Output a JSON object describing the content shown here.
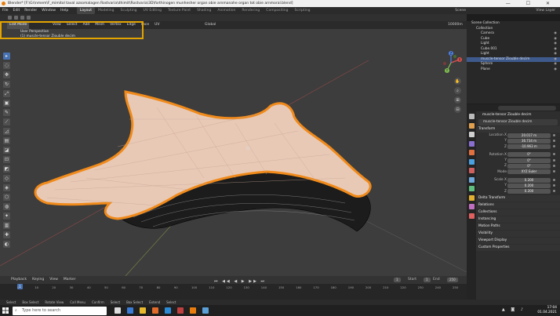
{
  "window": {
    "title": "Blender* [F:\\Gr\\nmem\\F_mimitol taval azsomalagen Rostvaria\\dhimit\\Rostvaria\\3D\\forthinogen munhesher organ obie arnmanahe organ tot obie arnmoral.blend]",
    "controls": "—  ☐  ✕"
  },
  "menu": {
    "items": [
      "File",
      "Edit",
      "Render",
      "Window",
      "Help"
    ],
    "workspaces": [
      "Layout",
      "Modeling",
      "Sculpting",
      "UV Editing",
      "Texture Paint",
      "Shading",
      "Animation",
      "Rendering",
      "Compositing",
      "Scripting"
    ],
    "active_workspace": "Layout",
    "scene": "Scene",
    "view_layer": "View Layer"
  },
  "viewport": {
    "mode": "Edit Mode",
    "menu": [
      "View",
      "Select",
      "Add",
      "Mesh",
      "Vertex",
      "Edge",
      "Face",
      "UV"
    ],
    "transform_orientation": "Global",
    "snap_label": "10000m",
    "perspective": "User Perspective",
    "object_info": "(1) muscle-tensor Ziouble decim",
    "tools": [
      "▸",
      "◌",
      "✥",
      "↻",
      "⤢",
      "▣",
      "✎",
      "⟋",
      "◿",
      "▤",
      "◪",
      "⊡",
      "◩",
      "◇",
      "◈",
      "⬡",
      "◍",
      "✦",
      "▥",
      "✚",
      "◐"
    ],
    "nav_buttons": [
      "✋",
      "⌕",
      "⊞",
      "⊟"
    ],
    "gizmo_axes": [
      "X",
      "Y",
      "Z"
    ]
  },
  "timeline": {
    "menu": [
      "Playback",
      "Keying",
      "View",
      "Marker"
    ],
    "controls": "⏮ ◀◀ ◀ ▶ ▶▶ ⏭",
    "current_frame": "1",
    "start_label": "Start",
    "start": "1",
    "end_label": "End",
    "end": "250",
    "ticks": [
      "0",
      "10",
      "20",
      "30",
      "40",
      "50",
      "60",
      "70",
      "80",
      "90",
      "100",
      "110",
      "120",
      "130",
      "140",
      "150",
      "160",
      "170",
      "180",
      "190",
      "200",
      "210",
      "220",
      "230",
      "240",
      "250"
    ]
  },
  "status": {
    "items": [
      "Select",
      "Box Select",
      "Rotate View",
      "Call Menu",
      "Confirm",
      "Select",
      "Box Select",
      "Extend",
      "Select"
    ]
  },
  "outliner": {
    "rows": [
      {
        "label": "Scene Collection",
        "indent": 1
      },
      {
        "label": "Collection",
        "indent": 2
      },
      {
        "label": "Camera",
        "indent": 3
      },
      {
        "label": "Cube",
        "indent": 3
      },
      {
        "label": "Light",
        "indent": 3
      },
      {
        "label": "Cube.001",
        "indent": 3
      },
      {
        "label": "Light",
        "indent": 3
      },
      {
        "label": "muscle-tensor Ziouble decim",
        "indent": 3,
        "active": true
      },
      {
        "label": "Sphere",
        "indent": 3
      },
      {
        "label": "Plane",
        "indent": 3
      }
    ]
  },
  "properties": {
    "object_name": "muscle-tensor Ziouble decim",
    "object_field": "muscle-tensor Ziouble decim",
    "transform_title": "Transform",
    "location_label": "Location X",
    "location": [
      "20.017 m",
      "36.734 m",
      "-10.963 m"
    ],
    "rotation_label": "Rotation X",
    "rotation": [
      "0°",
      "0°",
      "0°"
    ],
    "mode_label": "Mode",
    "mode": "XYZ Euler",
    "scale_label": "Scale X",
    "scale": [
      "0.200",
      "0.200",
      "0.200"
    ],
    "axis_labels": [
      "Y",
      "Z"
    ],
    "sections": [
      "Delta Transform",
      "Relations",
      "Collections",
      "Instancing",
      "Motion Paths",
      "Visibility",
      "Viewport Display",
      "Custom Properties"
    ],
    "tab_colors": [
      "#bbbbbb",
      "#e0a050",
      "#d0d0d0",
      "#8a6fd0",
      "#e07040",
      "#4aa0e0",
      "#d06060",
      "#6fa8dc",
      "#5fbf7f",
      "#e0b030",
      "#c06fc0",
      "#e06060"
    ]
  },
  "taskbar": {
    "search_placeholder": "Type here to search",
    "time": "17:04",
    "date": "01.04.2021",
    "app_colors": [
      "#dddddd",
      "#3a7bd5",
      "#e8b92c",
      "#e06b2a",
      "#2a8ad5",
      "#c04040",
      "#e87d0d",
      "#5a9fd5"
    ]
  }
}
